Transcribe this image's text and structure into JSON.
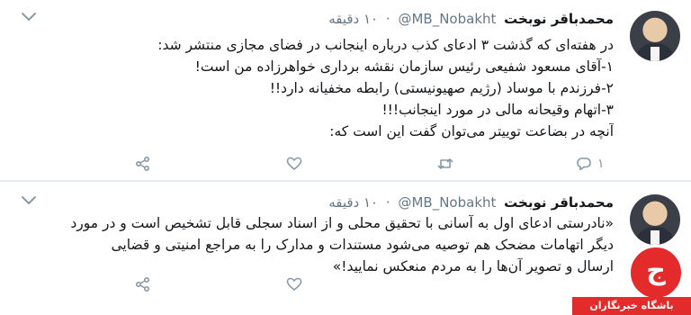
{
  "tweets": [
    {
      "author": "محمدباقر نوبخت",
      "handle": "@MB_Nobakht",
      "time": "۱۰ دقیقه",
      "lines": [
        "در هفته‌ای که گذشت ۳ ادعای کذب درباره اینجانب در فضای مجازی منتشر شد:",
        "۱-آقای مسعود شفیعی رئیس سازمان نقشه برداری خواهرزاده من است!",
        "۲-فرزندم با موساد (رژیم صهیونیستی) رابطه مخفیانه دارد!!",
        "۳-اتهام وقیحانه مالی در مورد اینجانب!!!",
        "آنچه در بضاعت توییتر می‌توان گفت این است که:"
      ],
      "reply_count": "۱"
    },
    {
      "author": "محمدباقر نوبخت",
      "handle": "@MB_Nobakht",
      "time": "۱۰ دقیقه",
      "lines": [
        "«نادرستی ادعای اول به آسانی با تحقیق محلی و از اسناد سجلی قابل تشخیص است و در مورد",
        "دیگر اتهامات مضحک هم توصیه می‌شود مستندات و مدارک را به مراجع امنیتی و قضایی",
        "ارسال و تصویر آن‌ها را به مردم منعکس نمایید!»"
      ]
    }
  ],
  "icons": {
    "reply": "reply-icon",
    "retweet": "retweet-icon",
    "like": "heart-icon",
    "share": "share-icon",
    "menu": "chevron-down-icon"
  },
  "watermark": {
    "site": "باشگاه خبرنگاران",
    "mark": "ج"
  },
  "colors": {
    "text": "#14171a",
    "muted": "#657786",
    "icon": "#8899a6",
    "divider": "#e6ecf0",
    "brand_red": "#e32b2b"
  }
}
